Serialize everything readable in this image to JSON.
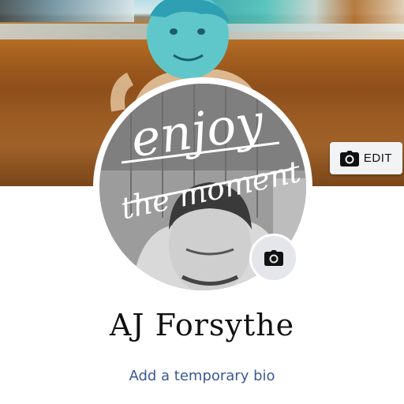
{
  "cover": {
    "edit_label": "EDIT",
    "edit_icon": "camera-icon"
  },
  "profile_photo": {
    "overlay_text_line1": "enjoy",
    "overlay_text_line2": "the moment",
    "update_icon": "camera-icon"
  },
  "profile": {
    "name": "AJ Forsythe",
    "bio_link": "Add a temporary bio"
  },
  "colors": {
    "link": "#3b5998",
    "button_bg": "#f2f3f5",
    "avatar_button_bg": "#e4e6eb"
  }
}
